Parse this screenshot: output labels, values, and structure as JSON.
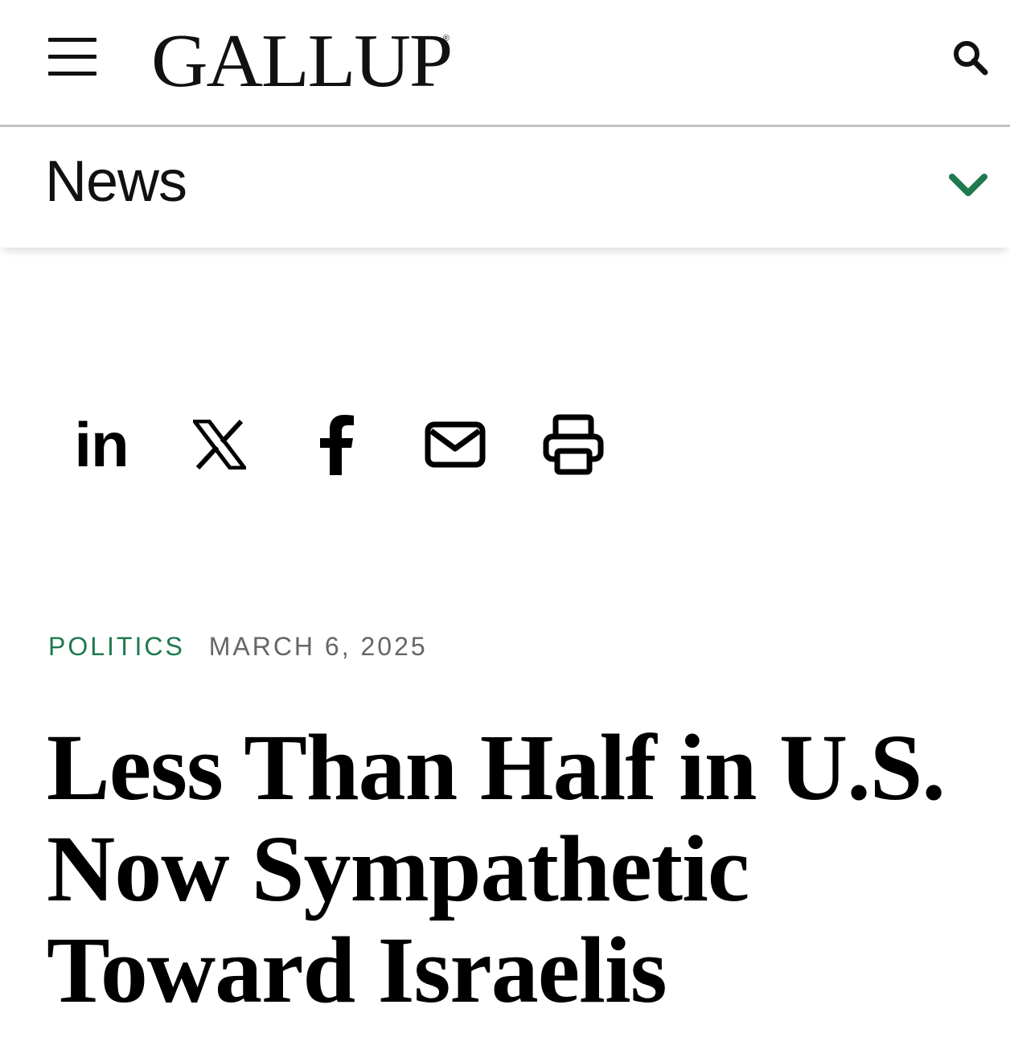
{
  "header": {
    "logo_text": "GALLUP",
    "logo_registered_mark": "®",
    "menu_icon": "hamburger-icon",
    "search_icon": "search-icon"
  },
  "section": {
    "title": "News",
    "expand_icon": "chevron-down-icon",
    "chevron_color": "#1e7a4e"
  },
  "share": {
    "items": [
      {
        "icon": "linkedin-icon",
        "glyph": "in"
      },
      {
        "icon": "x-icon"
      },
      {
        "icon": "facebook-icon"
      },
      {
        "icon": "email-icon"
      },
      {
        "icon": "print-icon"
      }
    ]
  },
  "article": {
    "category": "POLITICS",
    "date": "MARCH 6, 2025",
    "headline": "Less Than Half in U.S. Now Sympathetic Toward Israelis"
  },
  "colors": {
    "accent_green": "#1e7a4e",
    "meta_gray": "#666666",
    "divider": "#c4c4c4"
  }
}
